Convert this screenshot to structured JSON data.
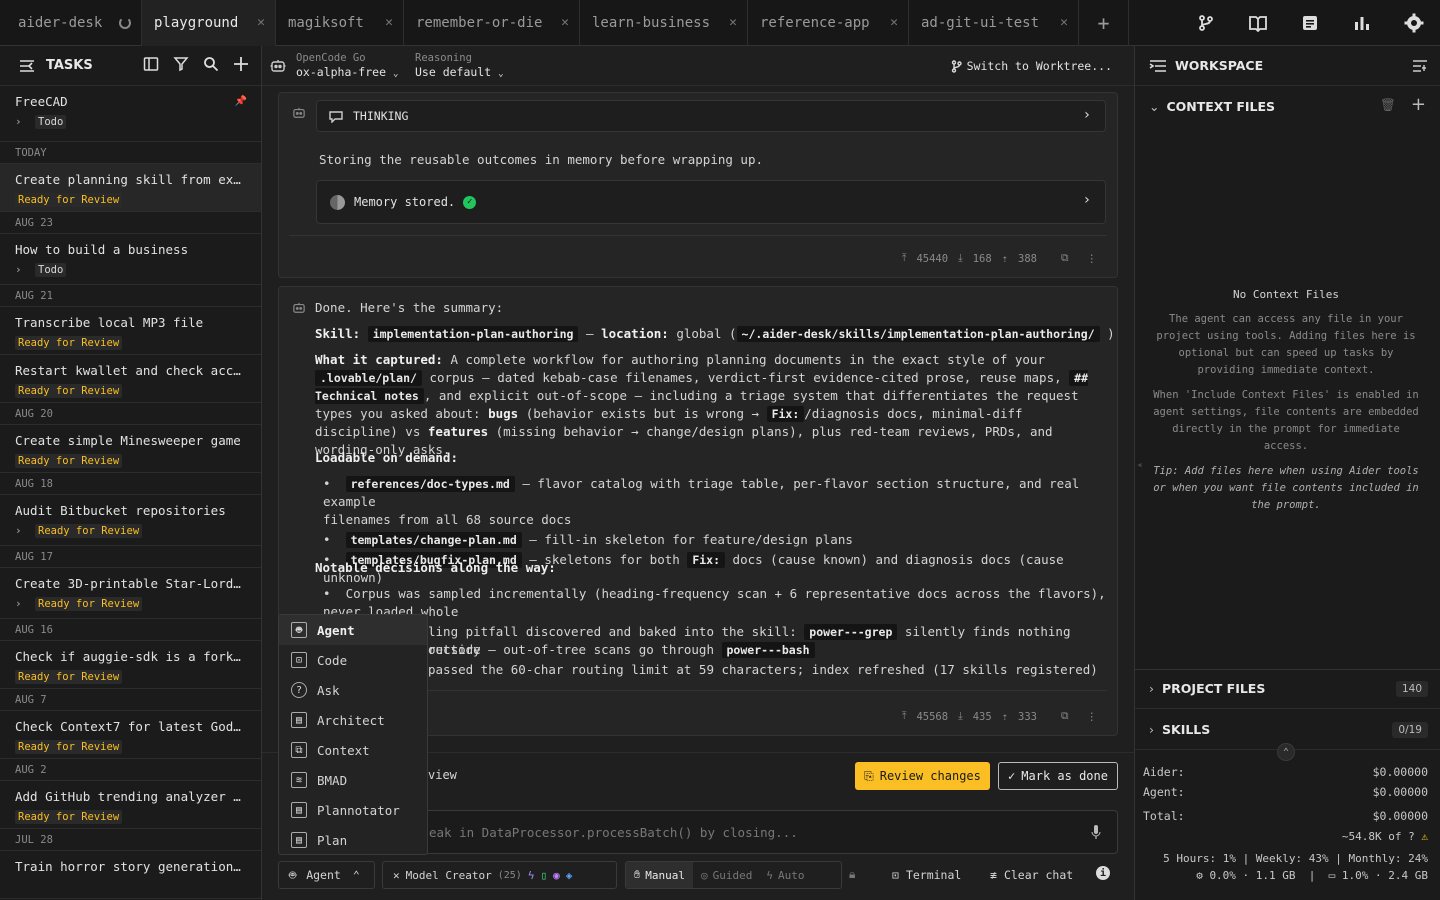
{
  "tabs": [
    {
      "label": "aider-desk",
      "loading": true
    },
    {
      "label": "playground",
      "active": true
    },
    {
      "label": "magiksoft"
    },
    {
      "label": "remember-or-die"
    },
    {
      "label": "learn-business"
    },
    {
      "label": "reference-app"
    },
    {
      "label": "ad-git-ui-test"
    }
  ],
  "sidebar": {
    "title": "TASKS",
    "pinned": {
      "name": "FreeCAD",
      "status": "Todo"
    },
    "groups": [
      {
        "date": "TODAY",
        "tasks": [
          {
            "name": "Create planning skill from exis…",
            "status": "Ready for Review",
            "selected": true
          }
        ]
      },
      {
        "date": "AUG 23",
        "tasks": [
          {
            "name": "How to build a business",
            "status": "Todo",
            "expandable": true
          }
        ]
      },
      {
        "date": "AUG 21",
        "tasks": [
          {
            "name": "Transcribe local MP3 file",
            "status": "Ready for Review"
          },
          {
            "name": "Restart kwallet and check accou…",
            "status": "Ready for Review"
          }
        ]
      },
      {
        "date": "AUG 20",
        "tasks": [
          {
            "name": "Create simple Minesweeper game",
            "status": "Ready for Review"
          }
        ]
      },
      {
        "date": "AUG 18",
        "tasks": [
          {
            "name": "Audit Bitbucket repositories",
            "status": "Ready for Review",
            "expandable": true
          }
        ]
      },
      {
        "date": "AUG 17",
        "tasks": [
          {
            "name": "Create 3D-printable Star-Lord m…",
            "status": "Ready for Review",
            "expandable": true
          }
        ]
      },
      {
        "date": "AUG 16",
        "tasks": [
          {
            "name": "Check if auggie-sdk is a fork o…",
            "status": "Ready for Review"
          }
        ]
      },
      {
        "date": "AUG 7",
        "tasks": [
          {
            "name": "Check Context7 for latest Godot…",
            "status": "Ready for Review"
          }
        ]
      },
      {
        "date": "AUG 2",
        "tasks": [
          {
            "name": "Add GitHub trending analyzer ex…",
            "status": "Ready for Review"
          }
        ]
      },
      {
        "date": "JUL 28",
        "tasks": [
          {
            "name": "Train horror story generation m…",
            "status": ""
          }
        ]
      }
    ]
  },
  "topbar": {
    "provider_label": "OpenCode Go",
    "model": "ox-alpha-free",
    "reasoning_label": "Reasoning",
    "reasoning_value": "Use default",
    "worktree": "Switch to Worktree..."
  },
  "msg1": {
    "thinking_label": "THINKING",
    "text": "Storing the reusable outcomes in memory before wrapping up.",
    "memory": "Memory stored.",
    "stats": {
      "up": "45440",
      "down": "168",
      "out": "388"
    }
  },
  "msg2": {
    "intro": "Done. Here's the summary:",
    "skill_label": "Skill:",
    "skill_name": "implementation-plan-authoring",
    "location_label": "location:",
    "location_value": "global (",
    "location_path": "~/.aider-desk/skills/implementation-plan-authoring/",
    "captured_label": "What it captured:",
    "captured_1": " A complete workflow for authoring planning documents in the exact style of your",
    "captured_code1": ".lovable/plan/",
    "captured_2": " corpus — dated kebab-case filenames, verdict-first evidence-cited prose, reuse maps,",
    "captured_code2": "## Technical notes",
    "captured_3": ", and explicit out-of-scope — including a triage system that differentiates the request types",
    "captured_4": "you asked about: ",
    "bugs": "bugs",
    "captured_5": " (behavior exists but is wrong → ",
    "fix": "Fix:",
    "captured_6": "/diagnosis docs, minimal-diff discipline) vs",
    "features": "features",
    "captured_7": " (missing behavior → change/design plans), plus red-team reviews, PRDs, and wording-only asks.",
    "loadable_label": "Loadable on demand:",
    "loadable": [
      {
        "code": "references/doc-types.md",
        "text": " — flavor catalog with triage table, per-flavor section structure, and real example"
      },
      {
        "code": "",
        "text": "filenames from all 68 source docs"
      },
      {
        "code": "templates/change-plan.md",
        "text": " — fill-in skeleton for feature/design plans"
      },
      {
        "code": "templates/bugfix-plan.md",
        "text": " — skeletons for both "
      }
    ],
    "loadable_tail_code": "Fix:",
    "loadable_tail": " docs (cause known) and diagnosis docs (cause unknown)",
    "notable_label": "Notable decisions along the way:",
    "notable_1": "Corpus was sampled incrementally (heading-frequency scan + 6 representative docs across the flavors),",
    "notable_1b": "never loaded whole",
    "notable_2a": "ling pitfall discovered and baked into the skill: ",
    "notable_2code": "power---grep",
    "notable_2b": " silently finds nothing outside",
    "notable_3a": "rectory — out-of-tree scans go through ",
    "notable_3code": "power---bash",
    "notable_4": "passed the 60-char routing limit at 59 characters; index refreshed (17 skills registered)",
    "stats": {
      "up": "45568",
      "down": "435",
      "out": "333"
    }
  },
  "review": {
    "text": "view",
    "review_btn": "Review changes",
    "done_btn": "Mark as done"
  },
  "input": {
    "placeholder": "eak in DataProcessor.processBatch() by closing..."
  },
  "mode_menu": {
    "items": [
      {
        "label": "Agent",
        "icon": "robot-icon",
        "selected": true
      },
      {
        "label": "Code",
        "icon": "terminal-icon"
      },
      {
        "label": "Ask",
        "icon": "question-icon"
      },
      {
        "label": "Architect",
        "icon": "architect-icon"
      },
      {
        "label": "Context",
        "icon": "context-icon"
      },
      {
        "label": "BMAD",
        "icon": "layers-icon"
      },
      {
        "label": "Plannotator",
        "icon": "doc-icon"
      },
      {
        "label": "Plan",
        "icon": "plan-icon"
      }
    ]
  },
  "bottombar": {
    "mode": "Agent",
    "profile": "Model Creator",
    "profile_count": "(25)",
    "manual": "Manual",
    "guided": "Guided",
    "auto": "Auto",
    "terminal": "Terminal",
    "clear": "Clear chat"
  },
  "workspace": {
    "title": "WORKSPACE",
    "context_title": "CONTEXT FILES",
    "empty_title": "No Context Files",
    "empty_p1": "The agent can access any file in your project using tools. Adding files here is optional but can speed up tasks by providing immediate context.",
    "empty_p2": "When 'Include Context Files' is enabled in agent settings, file contents are embedded directly in the prompt for immediate access.",
    "empty_tip": "Tip: Add files here when using Aider tools or when you want file contents included in the prompt.",
    "project_files": "PROJECT FILES",
    "project_count": "140",
    "skills": "SKILLS",
    "skills_count": "0/19",
    "aider_label": "Aider:",
    "aider_cost": "$0.00000",
    "agent_label": "Agent:",
    "agent_cost": "$0.00000",
    "total_label": "Total:",
    "total_cost": "$0.00000",
    "tokens": "~54.8K of ?",
    "usage": "5 Hours: 1% | Weekly: 43% | Monthly: 24%",
    "cpu": "0.0% · 1.1 GB",
    "mem": "1.0% · 2.4 GB"
  },
  "colors": {
    "accent": "#fbbf24",
    "success": "#22c55e",
    "warn": "#facc15"
  }
}
